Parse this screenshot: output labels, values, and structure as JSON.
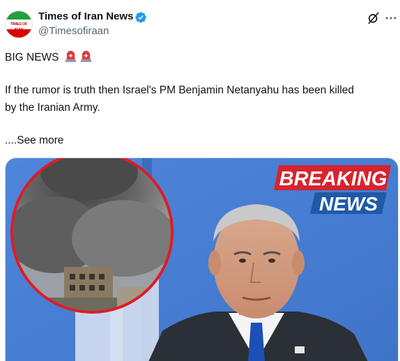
{
  "account": {
    "display_name": "Times of Iran News",
    "handle": "@Timesofiraan",
    "avatar_text": "TIMES OF IRAN",
    "verified": true
  },
  "post": {
    "headline": "BIG NEWS",
    "headline_emoji": [
      "police-light-emoji",
      "police-light-emoji"
    ],
    "body_line1": "If the rumor is truth then Israel's PM Benjamin Netanyahu has been killed",
    "body_line2": "by the Iranian Army.",
    "see_more": "....See more"
  },
  "media": {
    "banner_line1": "BREAKING",
    "banner_line2": "NEWS",
    "colors": {
      "banner_red": "#d7232e",
      "banner_blue": "#1f5aa6",
      "background_blue": "#5b8fe0",
      "inset_border": "#e01b24",
      "smoke": "#6b6b6b"
    }
  },
  "actions": {
    "grok_icon": "grok-icon",
    "more_icon": "more-icon"
  }
}
